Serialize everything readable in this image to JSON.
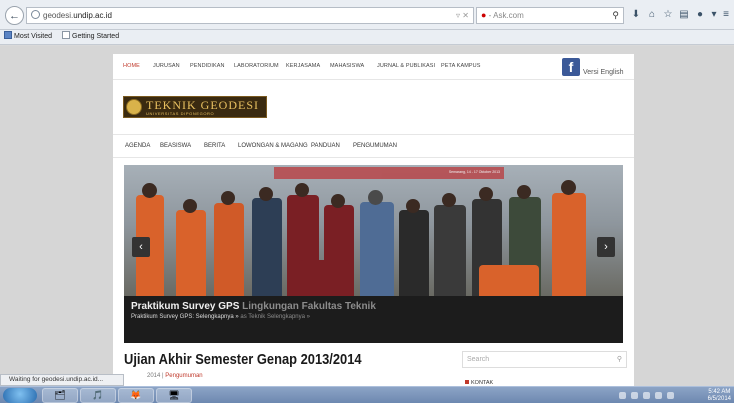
{
  "browser": {
    "url_prefix": "geodesi.",
    "url_host": "undip.ac.id",
    "url_actions": "▿ ✕",
    "search_engine_icon": "●",
    "search_placeholder": "- Ask.com",
    "bookmarks": [
      "Most Visited",
      "Getting Started"
    ],
    "status": "Waiting for geodesi.undip.ac.id..."
  },
  "site": {
    "topnav": [
      "HOME",
      "JURUSAN",
      "PENDIDIKAN",
      "LABORATORIUM",
      "KERJASAMA",
      "MAHASISWA",
      "JURNAL & PUBLIKASI",
      "PETA KAMPUS"
    ],
    "fb_letter": "f",
    "versi_label": "Versi English",
    "logo_name": "TEKNIK GEODESI",
    "logo_sub": "UNIVERSITAS DIPONEGORO",
    "subnav": [
      "AGENDA",
      "BEASISWA",
      "BERITA",
      "LOWONGAN & MAGANG",
      "PANDUAN",
      "PENGUMUMAN"
    ],
    "slide": {
      "banner_text": "Semarang, 14 - 17 Oktober 2013",
      "caption_title_main": "Praktikum Survey GPS",
      "caption_title_ghost": " Lingkungan Fakultas Teknik",
      "caption_sub_main": "Praktikum Survey GPS: Selengkapnya »",
      "caption_sub_ghost": " as Teknik Selengkapnya »",
      "prev": "‹",
      "next": "›"
    },
    "article": {
      "headline": "Ujian Akhir Semester Genap 2013/2014",
      "date_fragment": "2014",
      "separator": "|",
      "category": "Pengumuman"
    },
    "sidebar": {
      "search_placeholder": "Search",
      "kontak": "KONTAK"
    }
  },
  "taskbar": {
    "apps": [
      "🗂",
      "🎵",
      "🦊",
      "🖥"
    ],
    "time": "5:42 AM",
    "date": "6/5/2014"
  },
  "colors": {
    "accent": "#c0392b",
    "facebook": "#3b5998",
    "caption_bg": "#1c1c1c"
  }
}
